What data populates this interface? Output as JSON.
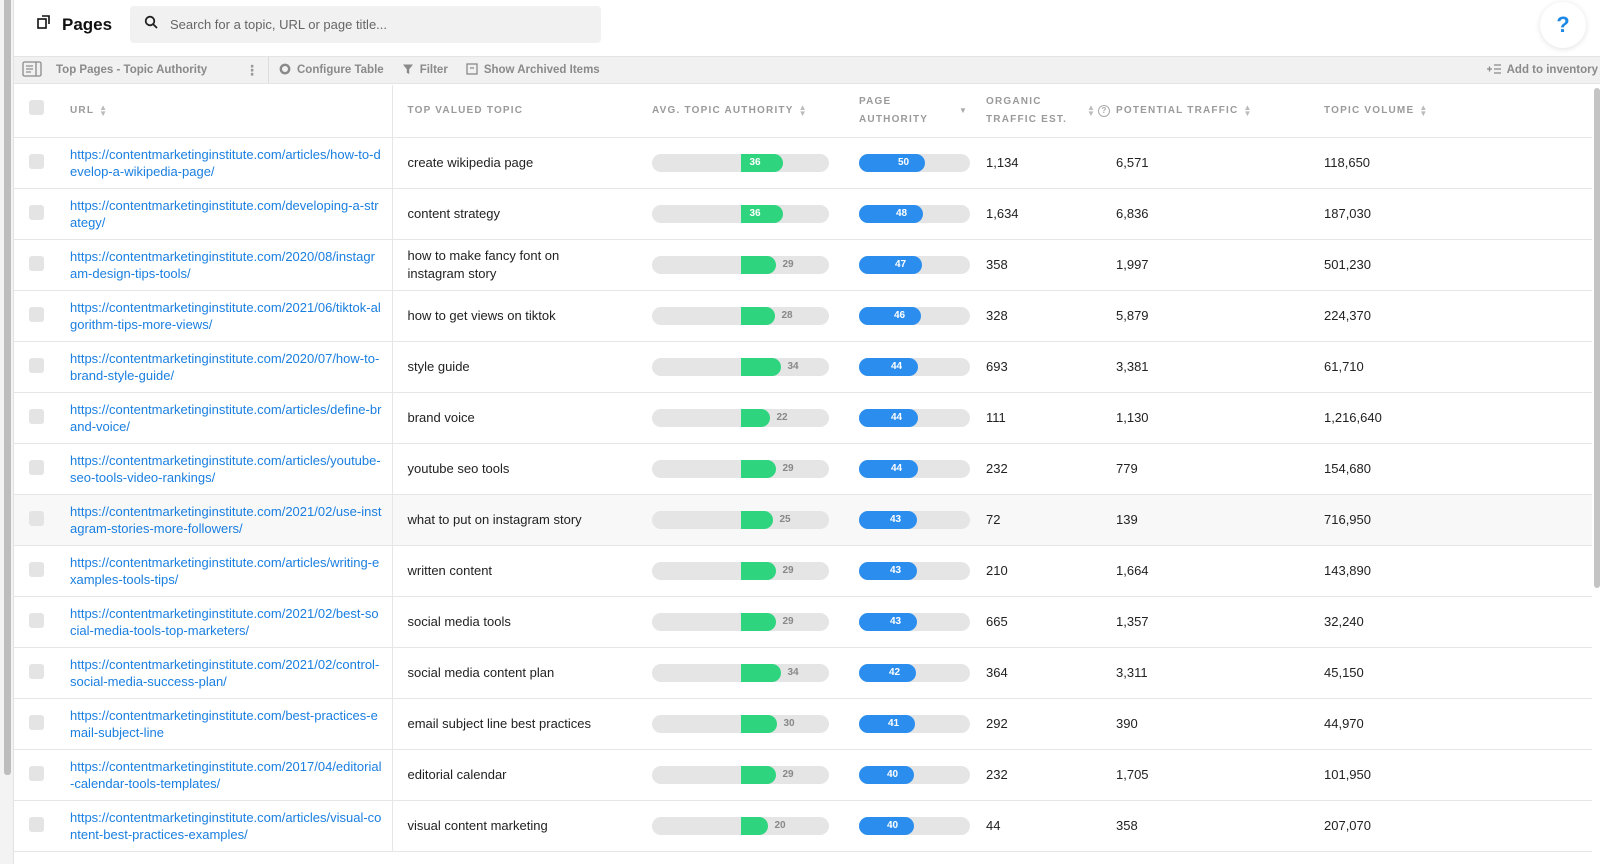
{
  "header": {
    "title": "Pages",
    "title_icon": "pages-icon",
    "search": {
      "placeholder": "Search for a topic, URL or page title...",
      "value": "",
      "icon": "search-icon"
    },
    "help_label": "?"
  },
  "toolbar": {
    "view_name": "Top Pages - Topic Authority",
    "kebab": "⋮",
    "configure_label": "Configure Table",
    "filter_label": "Filter",
    "archived_label": "Show Archived Items",
    "add_inventory_label": "Add to inventory"
  },
  "table": {
    "columns": {
      "url": "URL",
      "topic": "Top Valued Topic",
      "ata": "Avg. Topic Authority",
      "pa_line1": "Page",
      "pa_line2": "Authority",
      "ote_line1": "Organic",
      "ote_line2": "Traffic Est.",
      "pt": "Potential Traffic",
      "tv": "Topic Volume"
    },
    "hover_row_index": 7,
    "rows": [
      {
        "url": "https://contentmarketinginstitute.com/articles/how-to-develop-a-wikipedia-page/",
        "topic": "create wikipedia page",
        "avg_topic_authority": 36,
        "page_authority": 50,
        "organic_traffic_est": "1,134",
        "potential_traffic": "6,571",
        "topic_volume": "118,650"
      },
      {
        "url": "https://contentmarketinginstitute.com/developing-a-strategy/",
        "topic": "content strategy",
        "avg_topic_authority": 36,
        "page_authority": 48,
        "organic_traffic_est": "1,634",
        "potential_traffic": "6,836",
        "topic_volume": "187,030"
      },
      {
        "url": "https://contentmarketinginstitute.com/2020/08/instagram-design-tips-tools/",
        "topic": "how to make fancy font on instagram story",
        "avg_topic_authority": 29,
        "page_authority": 47,
        "organic_traffic_est": "358",
        "potential_traffic": "1,997",
        "topic_volume": "501,230"
      },
      {
        "url": "https://contentmarketinginstitute.com/2021/06/tiktok-algorithm-tips-more-views/",
        "topic": "how to get views on tiktok",
        "avg_topic_authority": 28,
        "page_authority": 46,
        "organic_traffic_est": "328",
        "potential_traffic": "5,879",
        "topic_volume": "224,370"
      },
      {
        "url": "https://contentmarketinginstitute.com/2020/07/how-to-brand-style-guide/",
        "topic": "style guide",
        "avg_topic_authority": 34,
        "page_authority": 44,
        "organic_traffic_est": "693",
        "potential_traffic": "3,381",
        "topic_volume": "61,710"
      },
      {
        "url": "https://contentmarketinginstitute.com/articles/define-brand-voice/",
        "topic": "brand voice",
        "avg_topic_authority": 22,
        "page_authority": 44,
        "organic_traffic_est": "111",
        "potential_traffic": "1,130",
        "topic_volume": "1,216,640"
      },
      {
        "url": "https://contentmarketinginstitute.com/articles/youtube-seo-tools-video-rankings/",
        "topic": "youtube seo tools",
        "avg_topic_authority": 29,
        "page_authority": 44,
        "organic_traffic_est": "232",
        "potential_traffic": "779",
        "topic_volume": "154,680"
      },
      {
        "url": "https://contentmarketinginstitute.com/2021/02/use-instagram-stories-more-followers/",
        "topic": "what to put on instagram story",
        "avg_topic_authority": 25,
        "page_authority": 43,
        "organic_traffic_est": "72",
        "potential_traffic": "139",
        "topic_volume": "716,950"
      },
      {
        "url": "https://contentmarketinginstitute.com/articles/writing-examples-tools-tips/",
        "topic": "written content",
        "avg_topic_authority": 29,
        "page_authority": 43,
        "organic_traffic_est": "210",
        "potential_traffic": "1,664",
        "topic_volume": "143,890"
      },
      {
        "url": "https://contentmarketinginstitute.com/2021/02/best-social-media-tools-top-marketers/",
        "topic": "social media tools",
        "avg_topic_authority": 29,
        "page_authority": 43,
        "organic_traffic_est": "665",
        "potential_traffic": "1,357",
        "topic_volume": "32,240"
      },
      {
        "url": "https://contentmarketinginstitute.com/2021/02/control-social-media-success-plan/",
        "topic": "social media content plan",
        "avg_topic_authority": 34,
        "page_authority": 42,
        "organic_traffic_est": "364",
        "potential_traffic": "3,311",
        "topic_volume": "45,150"
      },
      {
        "url": "https://contentmarketinginstitute.com/best-practices-email-subject-line",
        "topic": "email subject line best practices",
        "avg_topic_authority": 30,
        "page_authority": 41,
        "organic_traffic_est": "292",
        "potential_traffic": "390",
        "topic_volume": "44,970"
      },
      {
        "url": "https://contentmarketinginstitute.com/2017/04/editorial-calendar-tools-templates/",
        "topic": "editorial calendar",
        "avg_topic_authority": 29,
        "page_authority": 40,
        "organic_traffic_est": "232",
        "potential_traffic": "1,705",
        "topic_volume": "101,950"
      },
      {
        "url": "https://contentmarketinginstitute.com/articles/visual-content-best-practices-examples/",
        "topic": "visual content marketing",
        "avg_topic_authority": 20,
        "page_authority": 40,
        "organic_traffic_est": "44",
        "potential_traffic": "358",
        "topic_volume": "207,070"
      }
    ]
  },
  "colors": {
    "link": "#1b7fe0",
    "topic_authority_bar": "#2fd47e",
    "page_authority_bar": "#2b8eee",
    "track": "#e5e5e5"
  }
}
